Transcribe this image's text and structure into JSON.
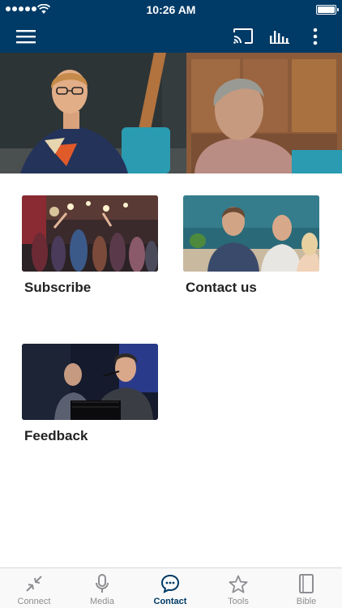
{
  "status_bar": {
    "time": "10:26 AM"
  },
  "nav": {
    "menu_icon": "hamburger-menu-icon",
    "cast_icon": "cast-icon",
    "stats_icon": "audio-bars-icon",
    "more_icon": "vertical-dots-icon"
  },
  "cards": [
    {
      "label": "Subscribe"
    },
    {
      "label": "Contact us"
    },
    {
      "label": "Feedback"
    }
  ],
  "tabs": [
    {
      "label": "Connect",
      "icon": "compress-arrows-icon",
      "active": false
    },
    {
      "label": "Media",
      "icon": "microphone-icon",
      "active": false
    },
    {
      "label": "Contact",
      "icon": "chat-bubble-icon",
      "active": true
    },
    {
      "label": "Tools",
      "icon": "star-icon",
      "active": false
    },
    {
      "label": "Bible",
      "icon": "book-icon",
      "active": false
    }
  ],
  "colors": {
    "brand": "#003a66",
    "tab_inactive": "#8e8e93",
    "tab_active": "#003a66"
  }
}
